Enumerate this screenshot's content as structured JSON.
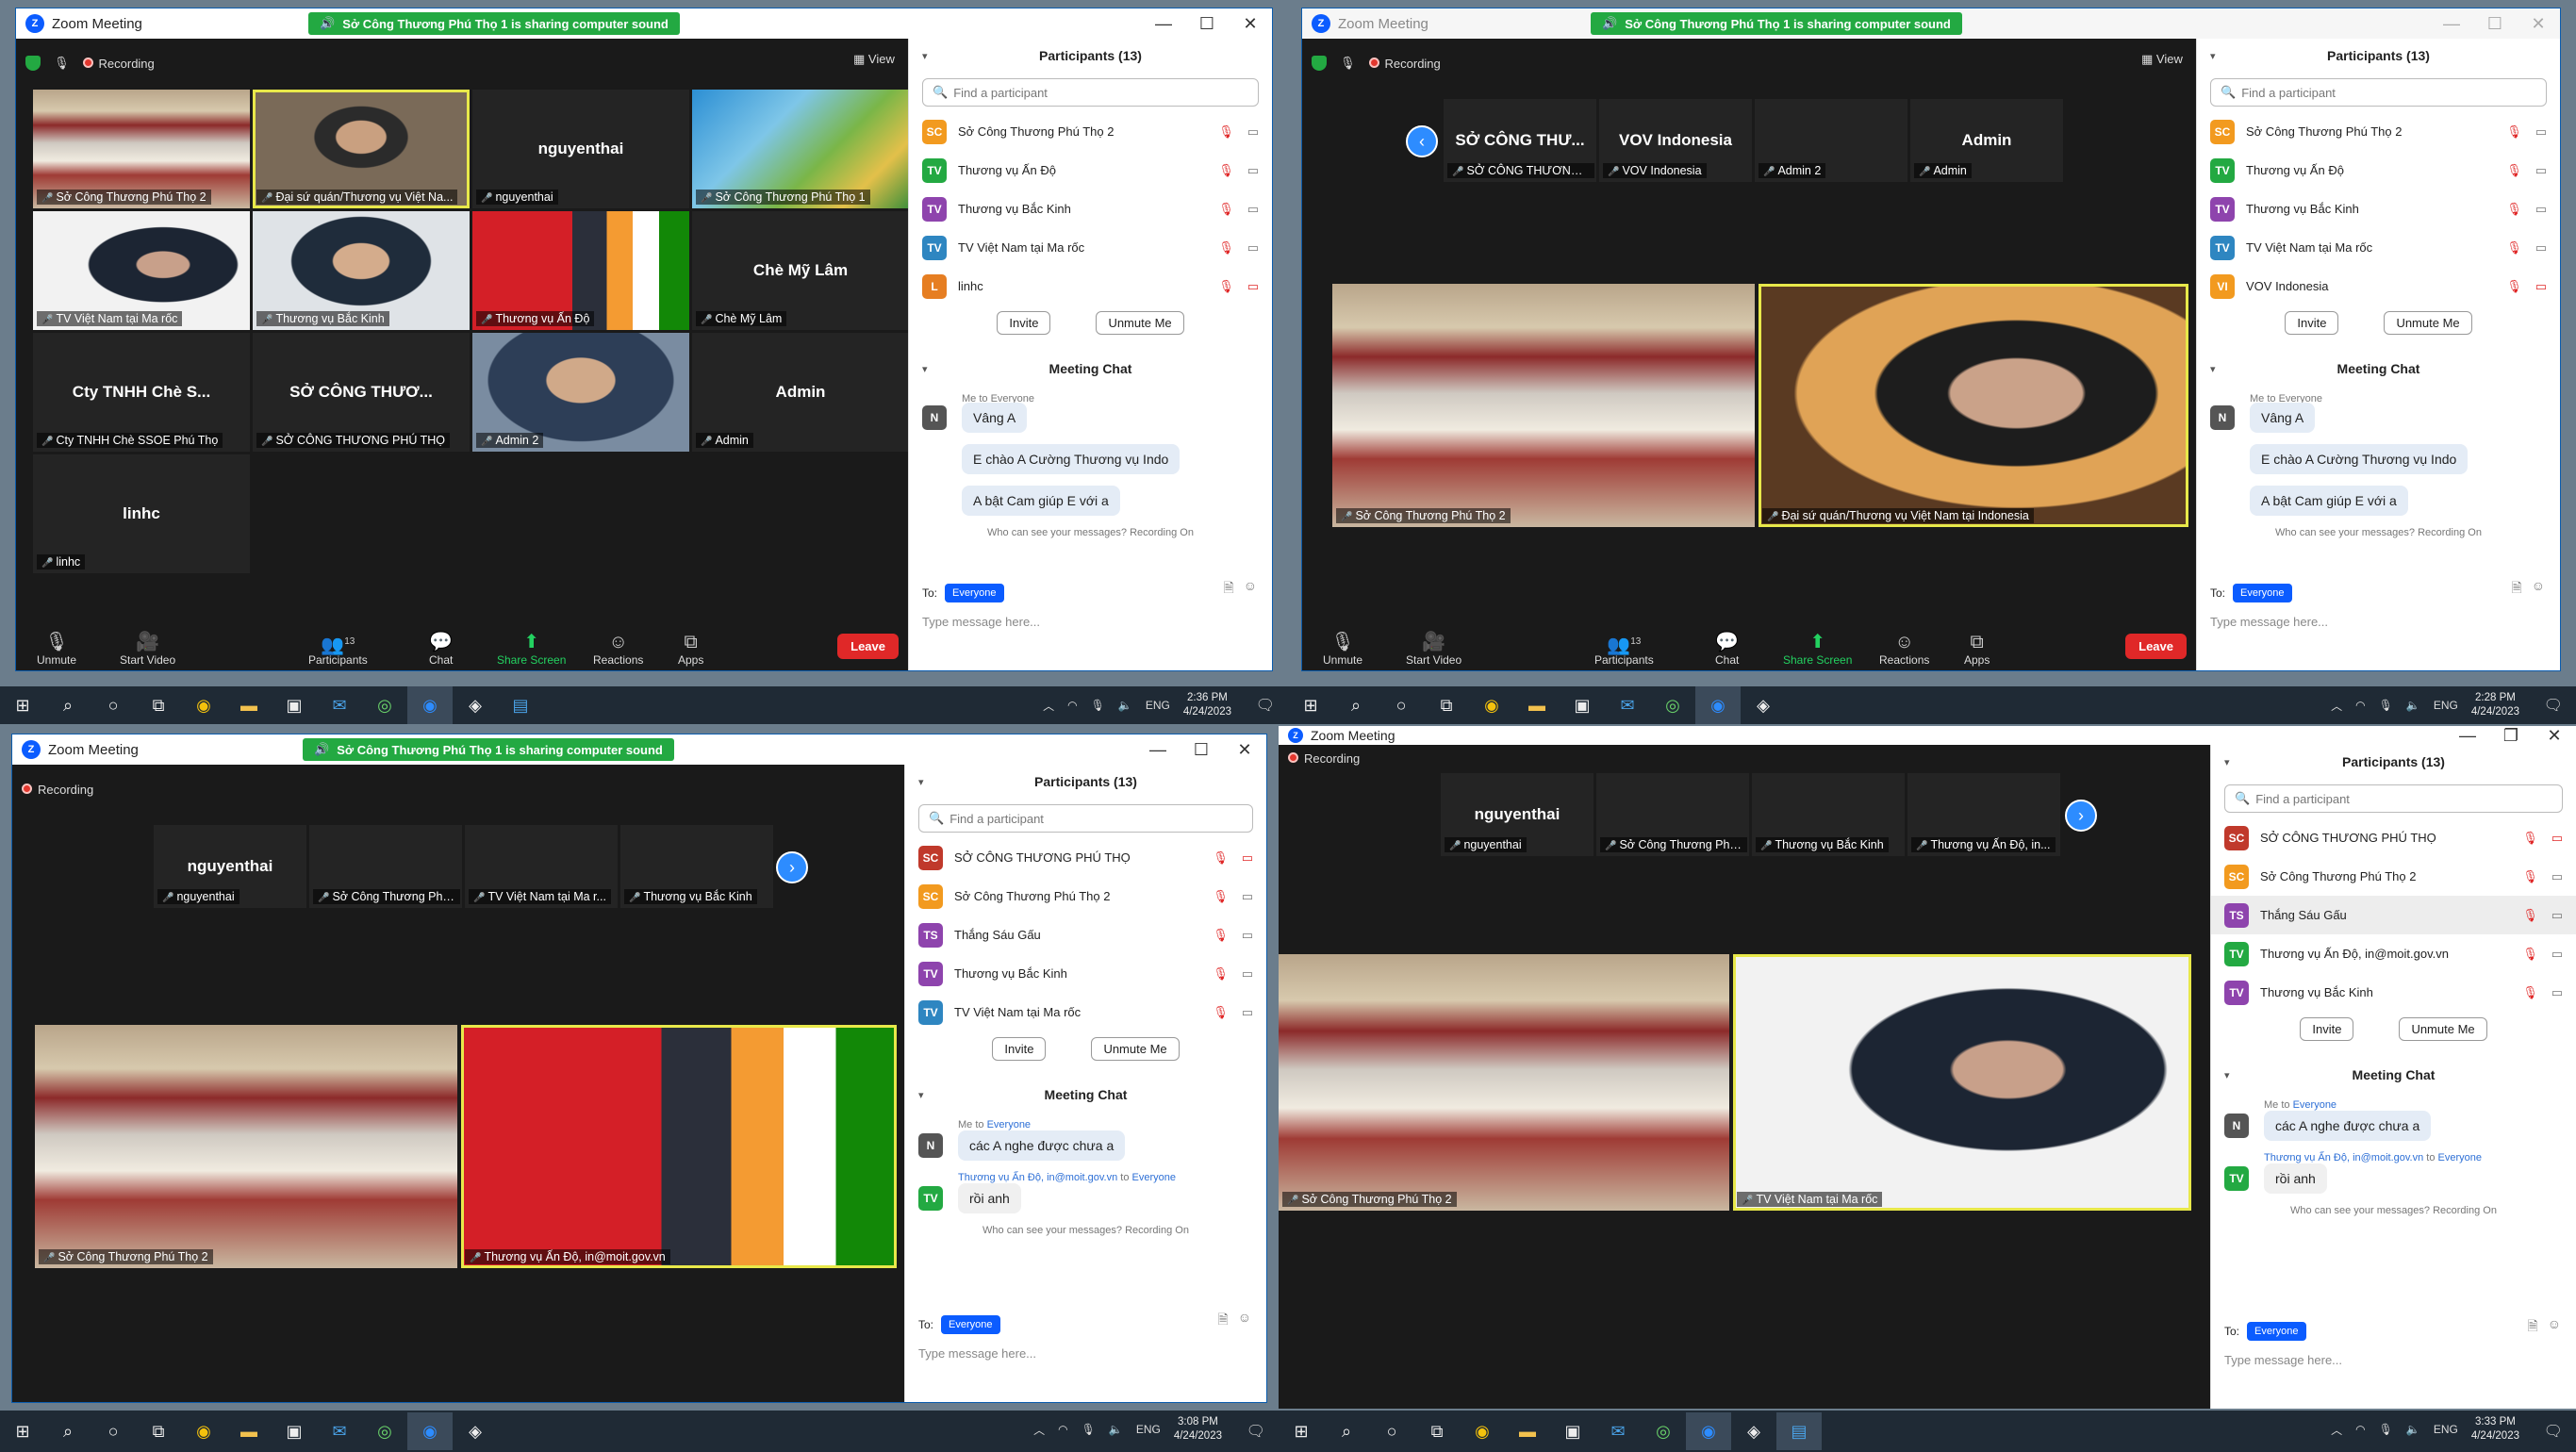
{
  "app_title": "Zoom Meeting",
  "sharing_banner": "Sở Công Thương Phú Thọ 1 is sharing computer sound",
  "recording_label": "Recording",
  "view_label": "View",
  "toolbar": {
    "unmute": "Unmute",
    "start_video": "Start Video",
    "participants": "Participants",
    "participant_count": "13",
    "chat": "Chat",
    "share_screen": "Share Screen",
    "reactions": "Reactions",
    "apps": "Apps",
    "leave": "Leave"
  },
  "panel": {
    "participants_title": "Participants (13)",
    "search_placeholder": "Find a participant",
    "invite": "Invite",
    "unmute_me": "Unmute Me",
    "chat_title": "Meeting Chat",
    "who_can_see": "Who can see your messages? Recording On",
    "to_label": "To:",
    "everyone": "Everyone",
    "type_message": "Type message here..."
  },
  "window1": {
    "gallery": [
      {
        "label": "Sở Công Thương Phú Thọ 2",
        "video": "hall"
      },
      {
        "label": "Đại sứ quán/Thương vụ  Việt Na...",
        "video": "person",
        "highlight": true
      },
      {
        "label": "nguyenthai",
        "name": "nguyenthai"
      },
      {
        "label": "Sở Công Thương Phú Thọ 1",
        "video": "banner"
      },
      {
        "label": "TV Việt Nam tại Ma rốc",
        "video": "office"
      },
      {
        "label": "Thương vụ Bắc Kinh",
        "video": "person2"
      },
      {
        "label": "Thương vụ Ấn Độ",
        "video": "flags"
      },
      {
        "label": "Chè Mỹ Lâm",
        "name": "Chè Mỹ Lâm"
      },
      {
        "label": "Cty TNHH Chè SSOE Phú Thọ",
        "name": "Cty TNHH Chè S..."
      },
      {
        "label": "SỞ CÔNG THƯƠNG PHÚ THỌ",
        "name": "SỞ CÔNG THƯƠ..."
      },
      {
        "label": "Admin 2",
        "video": "small"
      },
      {
        "label": "Admin",
        "name": "Admin"
      },
      {
        "label": "linhc",
        "name": "linhc"
      }
    ],
    "participants": [
      {
        "initials": "SC",
        "color": "#f29a1f",
        "name": "Sở Công Thương Phú Thọ 2",
        "cam_off": false
      },
      {
        "initials": "TV",
        "color": "#23a942",
        "name": "Thương vụ Ấn Độ",
        "cam_off": false
      },
      {
        "initials": "TV",
        "color": "#8e44ad",
        "name": "Thương vụ Bắc Kinh",
        "cam_off": false
      },
      {
        "initials": "TV",
        "color": "#2e86c1",
        "name": "TV Việt Nam tại Ma rốc",
        "cam_off": false
      },
      {
        "initials": "L",
        "color": "#e67e22",
        "name": "linhc",
        "cam_off": true
      }
    ],
    "chat_header": "Me to Everyone",
    "chat": [
      "Vâng A",
      "E chào A Cường Thương vụ Indo",
      "A bật Cam giúp E với a"
    ],
    "time": "2:36 PM",
    "date": "4/24/2023"
  },
  "window2": {
    "strip": [
      {
        "label": "SỞ CÔNG THƯƠNG ...",
        "name": "SỞ CÔNG THƯ..."
      },
      {
        "label": "VOV Indonesia",
        "name": "VOV Indonesia"
      },
      {
        "label": "Admin 2",
        "video": "small"
      },
      {
        "label": "Admin",
        "name": "Admin"
      }
    ],
    "main": [
      {
        "label": "Sở Công Thương Phú Thọ 2",
        "video": "hall"
      },
      {
        "label": "Đại sứ quán/Thương vụ  Việt Nam tại  Indonesia",
        "video": "sunset",
        "highlight": true
      }
    ],
    "participants": [
      {
        "initials": "SC",
        "color": "#f29a1f",
        "name": "Sở Công Thương Phú Thọ 2",
        "cam_off": false
      },
      {
        "initials": "TV",
        "color": "#23a942",
        "name": "Thương vụ Ấn Độ",
        "cam_off": false
      },
      {
        "initials": "TV",
        "color": "#8e44ad",
        "name": "Thương vụ Bắc Kinh",
        "cam_off": false
      },
      {
        "initials": "TV",
        "color": "#2e86c1",
        "name": "TV Việt Nam tại Ma rốc",
        "cam_off": false
      },
      {
        "initials": "VI",
        "color": "#f29a1f",
        "name": "VOV Indonesia",
        "cam_off": true
      }
    ],
    "chat_header": "Me to Everyone",
    "chat": [
      "Vâng A",
      "E chào A Cường Thương vụ Indo",
      "A bật Cam giúp E với a"
    ],
    "time": "2:28 PM",
    "date": "4/24/2023"
  },
  "window3": {
    "strip": [
      {
        "label": "nguyenthai",
        "name": "nguyenthai"
      },
      {
        "label": "Sở Công Thương Phú Th...",
        "video": "banner"
      },
      {
        "label": "TV Việt Nam tại Ma r...",
        "video": "office"
      },
      {
        "label": "Thương vụ Bắc Kinh",
        "video": "person2"
      }
    ],
    "main": [
      {
        "label": "Sở Công Thương Phú Thọ 2",
        "video": "hall"
      },
      {
        "label": "Thương vụ Ấn Độ, in@moit.gov.vn",
        "video": "flags",
        "highlight": true
      }
    ],
    "participants": [
      {
        "initials": "SC",
        "color": "#c0392b",
        "name": "SỞ CÔNG THƯƠNG PHÚ THỌ",
        "cam_off": true
      },
      {
        "initials": "SC",
        "color": "#f29a1f",
        "name": "Sở Công Thương Phú Thọ 2",
        "cam_off": false
      },
      {
        "initials": "TS",
        "color": "#8e44ad",
        "name": "Thắng Sáu Gấu",
        "cam_off": false
      },
      {
        "initials": "TV",
        "color": "#8e44ad",
        "name": "Thương vụ Bắc Kinh",
        "cam_off": false
      },
      {
        "initials": "TV",
        "color": "#2e86c1",
        "name": "TV Việt Nam tại Ma rốc",
        "cam_off": false
      }
    ],
    "chat_me": "Me to",
    "chat_me_to": "Everyone",
    "chat_msg1": "các A nghe được chưa a",
    "chat_from": "Thương vụ Ấn Độ, in@moit.gov.vn",
    "chat_to": "to",
    "chat_msg2": "rồi anh",
    "time": "3:08 PM",
    "date": "4/24/2023"
  },
  "window4": {
    "strip": [
      {
        "label": "nguyenthai",
        "name": "nguyenthai"
      },
      {
        "label": "Sở Công Thương Phú Th...",
        "video": "banner"
      },
      {
        "label": "Thương vụ Bắc Kinh",
        "video": "person2"
      },
      {
        "label": "Thương vụ Ấn Độ, in...",
        "video": "flags"
      }
    ],
    "main": [
      {
        "label": "Sở Công Thương Phú Thọ 2",
        "video": "hall"
      },
      {
        "label": "TV Việt Nam tại Ma rốc",
        "video": "office",
        "highlight": true
      }
    ],
    "participants": [
      {
        "initials": "SC",
        "color": "#c0392b",
        "name": "SỞ CÔNG THƯƠNG PHÚ THỌ",
        "cam_off": true
      },
      {
        "initials": "SC",
        "color": "#f29a1f",
        "name": "Sở Công Thương Phú Thọ 2",
        "cam_off": false
      },
      {
        "initials": "TS",
        "color": "#8e44ad",
        "name": "Thắng Sáu Gấu",
        "cam_off": false,
        "selected": true
      },
      {
        "initials": "TV",
        "color": "#23a942",
        "name": "Thương vụ Ấn Độ, in@moit.gov.vn",
        "cam_off": false
      },
      {
        "initials": "TV",
        "color": "#8e44ad",
        "name": "Thương vụ Bắc Kinh",
        "cam_off": false
      }
    ],
    "chat_me": "Me to",
    "chat_me_to": "Everyone",
    "chat_msg1": "các A nghe được chưa a",
    "chat_from": "Thương vụ Ấn Độ, in@moit.gov.vn",
    "chat_to": "to",
    "chat_msg2": "rồi anh",
    "time": "3:33 PM",
    "date": "4/24/2023"
  },
  "tray": {
    "lang": "ENG"
  },
  "chat_avatar_me": "N",
  "chat_avatar_tv": "TV"
}
